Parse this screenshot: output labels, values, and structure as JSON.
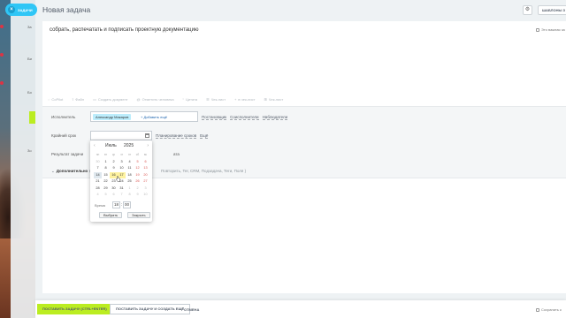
{
  "header": {
    "close_tab_label": "ЗАДАЧИ",
    "title": "Новая задача",
    "templates_label": "ШАБЛОНЫ З"
  },
  "task": {
    "title_text": "собрать, распечатать и подписать проектную документацию",
    "important_label": "Это важная за"
  },
  "toolbar": {
    "items": [
      "CoPilot",
      "Файл",
      "Создать документ",
      "Отметить человека",
      "Цитата",
      "Чек-лист",
      "в чек-лист",
      "Чек-лист"
    ]
  },
  "props": {
    "assignee_label": "Исполнитель",
    "assignee_chip": "Александр Макаров",
    "add_more": "+ Добавить ещё",
    "roles": [
      "Постановщик",
      "Соисполнители",
      "Наблюдатели"
    ],
    "deadline_label": "Крайний срок",
    "deadline_links": [
      "Планирование сроков",
      "Ещё"
    ],
    "result_label": "Результат задачи",
    "result_text": "ата",
    "more_label": "Дополнительно",
    "more_open": "(  Пр",
    "more_tail": "Повторить, Тег, CRM, Подзадача, Теги, Поля )"
  },
  "calendar": {
    "prev": "‹",
    "next": "›",
    "month": "Июль",
    "year": "2025",
    "weekdays": [
      "пн",
      "вт",
      "ср",
      "чт",
      "пт",
      "сб",
      "вс"
    ],
    "days": [
      {
        "d": "30",
        "o": 1
      },
      {
        "d": "1"
      },
      {
        "d": "2"
      },
      {
        "d": "3"
      },
      {
        "d": "4"
      },
      {
        "d": "5",
        "w": 1
      },
      {
        "d": "6",
        "w": 1
      },
      {
        "d": "7"
      },
      {
        "d": "8"
      },
      {
        "d": "9"
      },
      {
        "d": "10"
      },
      {
        "d": "11"
      },
      {
        "d": "12",
        "w": 1
      },
      {
        "d": "13",
        "w": 1
      },
      {
        "d": "14",
        "t": 1
      },
      {
        "d": "15"
      },
      {
        "d": "16",
        "s": 1
      },
      {
        "d": "17",
        "s": 1
      },
      {
        "d": "18"
      },
      {
        "d": "19",
        "w": 1
      },
      {
        "d": "20",
        "w": 1
      },
      {
        "d": "21"
      },
      {
        "d": "22"
      },
      {
        "d": "23"
      },
      {
        "d": "24"
      },
      {
        "d": "25"
      },
      {
        "d": "26",
        "w": 1
      },
      {
        "d": "27",
        "w": 1
      },
      {
        "d": "28"
      },
      {
        "d": "29"
      },
      {
        "d": "30"
      },
      {
        "d": "31"
      },
      {
        "d": "1",
        "o": 1
      },
      {
        "d": "2",
        "o": 1
      },
      {
        "d": "3",
        "o": 1
      },
      {
        "d": "4",
        "o": 1
      },
      {
        "d": "5",
        "o": 1
      },
      {
        "d": "6",
        "o": 1
      },
      {
        "d": "7",
        "o": 1
      },
      {
        "d": "8",
        "o": 1
      },
      {
        "d": "9",
        "o": 1
      },
      {
        "d": "10",
        "o": 1
      }
    ],
    "time_label": "Время",
    "hours": "18",
    "minutes": "00",
    "select_label": "Выбрать",
    "close_label": "Закрыть"
  },
  "footer": {
    "save_label": "ПОСТАВИТЬ ЗАДАЧУ (CTRL+ENTER)",
    "save_new_label": "ПОСТАВИТЬ ЗАДАЧУ И СОЗДАТЬ ЕЩЁ",
    "cancel_label": "ОТМЕНА",
    "save_template_label": "Сохранить к"
  },
  "background": {
    "labels": [
      "За",
      "Би",
      "Бо",
      "Зо"
    ]
  }
}
